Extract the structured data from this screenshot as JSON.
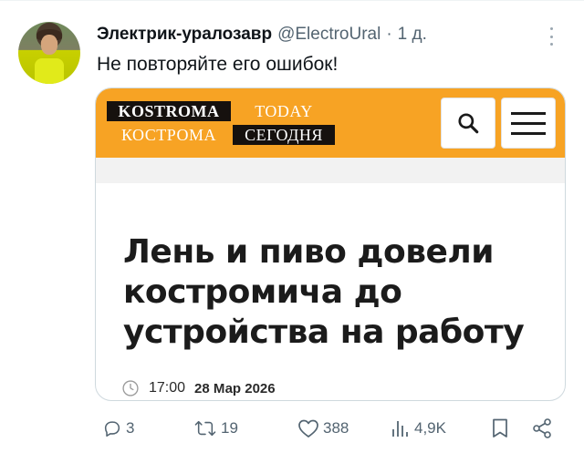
{
  "author": {
    "name": "Электрик-уралозавр",
    "handle": "@ElectroUral",
    "separator": "·",
    "time": "1 д."
  },
  "tweet": {
    "text": "Не повторяйте его ошибок!"
  },
  "card": {
    "logo": {
      "kostroma_en": "KOSTROMA",
      "today_en": "TODAY",
      "kostroma_ru": "КОСТРОМА",
      "segodnya_ru": "СЕГОДНЯ"
    },
    "headline": "Лень и пиво довели костромича до устройства на работу",
    "time": "17:00",
    "date": "28 Мар 2026"
  },
  "actions": {
    "replies": "3",
    "retweets": "19",
    "likes": "388",
    "views": "4,9K"
  },
  "colors": {
    "accent_orange": "#f7a324",
    "text_secondary": "#536471"
  },
  "icons": [
    "avatar-image",
    "more-icon",
    "search-icon",
    "menu-icon",
    "clock-icon",
    "reply-icon",
    "retweet-icon",
    "like-icon",
    "views-icon",
    "bookmark-icon",
    "share-icon"
  ]
}
